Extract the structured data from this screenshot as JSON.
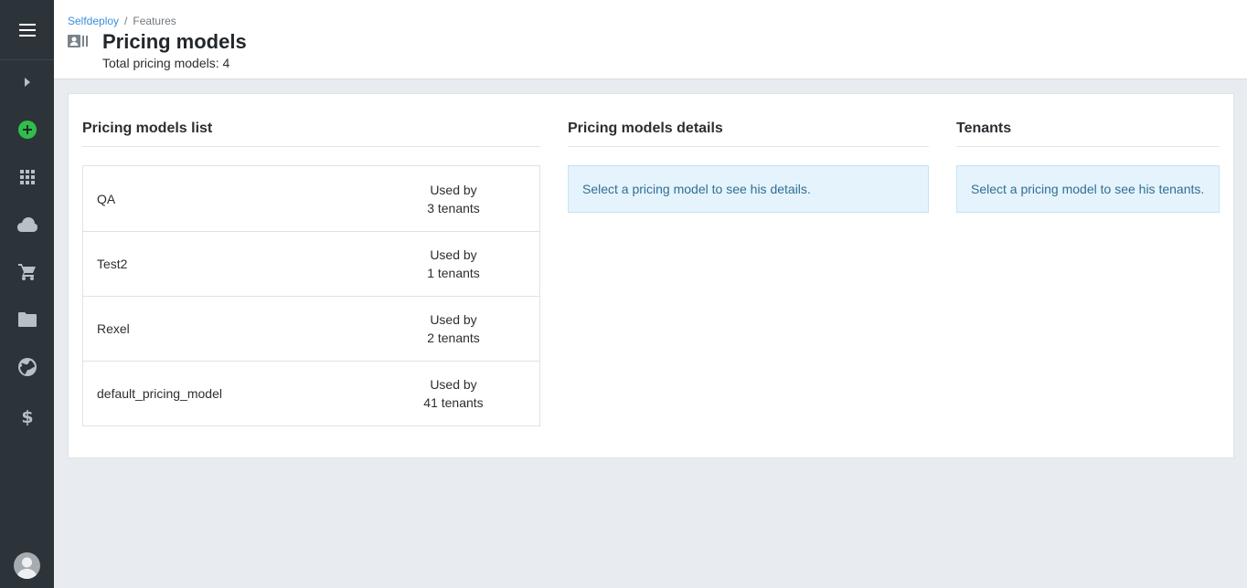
{
  "sidebar": {
    "menu_icon": "hamburger-menu-icon",
    "expand_icon": "chevron-right-icon",
    "items": [
      {
        "name": "add-icon",
        "color": "#2fbe4b"
      },
      {
        "name": "apps-grid-icon"
      },
      {
        "name": "cloud-icon"
      },
      {
        "name": "cart-icon"
      },
      {
        "name": "folder-icon"
      },
      {
        "name": "globe-icon"
      },
      {
        "name": "dollar-icon"
      }
    ],
    "avatar_icon": "user-avatar-icon"
  },
  "header": {
    "breadcrumb": [
      "Selfdeploy",
      "Features"
    ],
    "breadcrumb_sep": "/",
    "title_icon": "id-card-icon",
    "title": "Pricing models",
    "subtitle": "Total pricing models: 4"
  },
  "main": {
    "list_title": "Pricing models list",
    "details_title": "Pricing models details",
    "tenants_title": "Tenants",
    "models": [
      {
        "name": "QA",
        "used_label": "Used by",
        "tenants": "3 tenants"
      },
      {
        "name": "Test2",
        "used_label": "Used by",
        "tenants": "1 tenants"
      },
      {
        "name": "Rexel",
        "used_label": "Used by",
        "tenants": "2 tenants"
      },
      {
        "name": "default_pricing_model",
        "used_label": "Used by",
        "tenants": "41 tenants"
      }
    ],
    "details_message": "Select a pricing model to see his details.",
    "tenants_message": "Select a pricing model to see his tenants."
  },
  "colors": {
    "sidebar_bg": "#2c3339",
    "link": "#3a8fd9",
    "info_bg": "#e5f3fc",
    "info_text": "#2f6f95",
    "accent_green": "#2fbe4b"
  }
}
